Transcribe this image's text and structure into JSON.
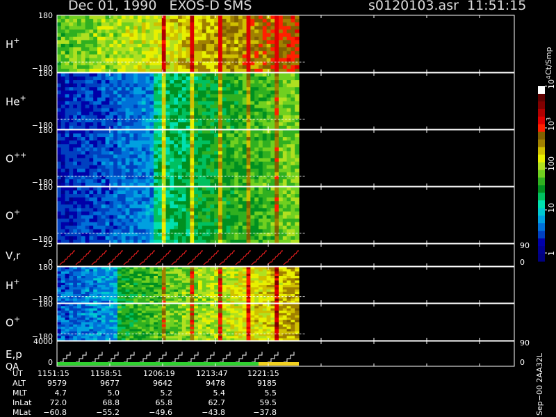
{
  "header": {
    "title_left": "Dec 01, 1990   EXOS-D SMS",
    "title_right": "s0120103.asr  11:51:15"
  },
  "panels": [
    {
      "name": "H+",
      "label": "H",
      "sup": "+",
      "ymax": "180",
      "ymin": "−180",
      "kind": "pitch"
    },
    {
      "name": "He+",
      "label": "He",
      "sup": "+",
      "ymax": "180",
      "ymin": "−180",
      "kind": "pitch"
    },
    {
      "name": "O++",
      "label": "O",
      "sup": "++",
      "ymax": "180",
      "ymin": "−180",
      "kind": "pitch"
    },
    {
      "name": "O+",
      "label": "O",
      "sup": "+",
      "ymax": "180",
      "ymin": "−180",
      "kind": "pitch"
    },
    {
      "name": "V,r",
      "label": "V,r",
      "sup": "",
      "ymax": "25",
      "ymin": "0",
      "right_max": "90",
      "right_min": "0",
      "kind": "line"
    },
    {
      "name": "H+ (energy)",
      "label": "H",
      "sup": "+",
      "ymax": "180",
      "ymin": "−180",
      "kind": "pitch"
    },
    {
      "name": "O+ (energy)",
      "label": "O",
      "sup": "+",
      "ymax": "180",
      "ymin": "−180",
      "kind": "pitch"
    },
    {
      "name": "E,p QA",
      "label": "E,p",
      "label2": "QA",
      "sup": "",
      "ymax": "4000",
      "ymin": "0",
      "right_max": "90",
      "right_min": "0",
      "kind": "step"
    }
  ],
  "colorbar": {
    "unit": "Ct/Smp",
    "tick_labels": [
      "1",
      "10",
      "100",
      "10",
      "10"
    ],
    "tick_sups": [
      "",
      "",
      "",
      "3",
      "4"
    ],
    "colors": [
      "#000080",
      "#00008f",
      "#0000a8",
      "#0040c0",
      "#0070d8",
      "#00a0e0",
      "#00c8d0",
      "#00e0b0",
      "#00c060",
      "#009020",
      "#30b020",
      "#70d020",
      "#b0e020",
      "#e8f000",
      "#d0c000",
      "#a08000",
      "#806000",
      "#ff2000",
      "#e00000",
      "#b00000",
      "#800000",
      "#600000",
      "#ffffff"
    ]
  },
  "footer": {
    "labels": [
      "UT",
      "ALT",
      "MLT",
      "InLat",
      "MLat"
    ],
    "columns": [
      [
        "1151:15",
        "9579",
        "4.7",
        "72.0",
        "−60.8"
      ],
      [
        "1158:51",
        "9677",
        "5.0",
        "68.8",
        "−55.2"
      ],
      [
        "1206:19",
        "9642",
        "5.2",
        "65.8",
        "−49.6"
      ],
      [
        "1213:47",
        "9478",
        "5.4",
        "62.7",
        "−43.8"
      ],
      [
        "1221:15",
        "9185",
        "5.5",
        "59.5",
        "−37.8"
      ]
    ],
    "plot_id": "Sep−00 2AA32L"
  },
  "chart_data": {
    "type": "heatmap",
    "title": "Dec 01, 1990   EXOS-D SMS",
    "x_ticks_ut": [
      "1151:15",
      "1158:51",
      "1206:19",
      "1213:47",
      "1221:15"
    ],
    "color_scale": {
      "type": "log",
      "range": [
        1,
        10000
      ],
      "unit": "Ct/Smp"
    },
    "panels": [
      "H+",
      "He+",
      "O++",
      "O+",
      "V,r",
      "H+",
      "O+",
      "E,p QA"
    ]
  }
}
